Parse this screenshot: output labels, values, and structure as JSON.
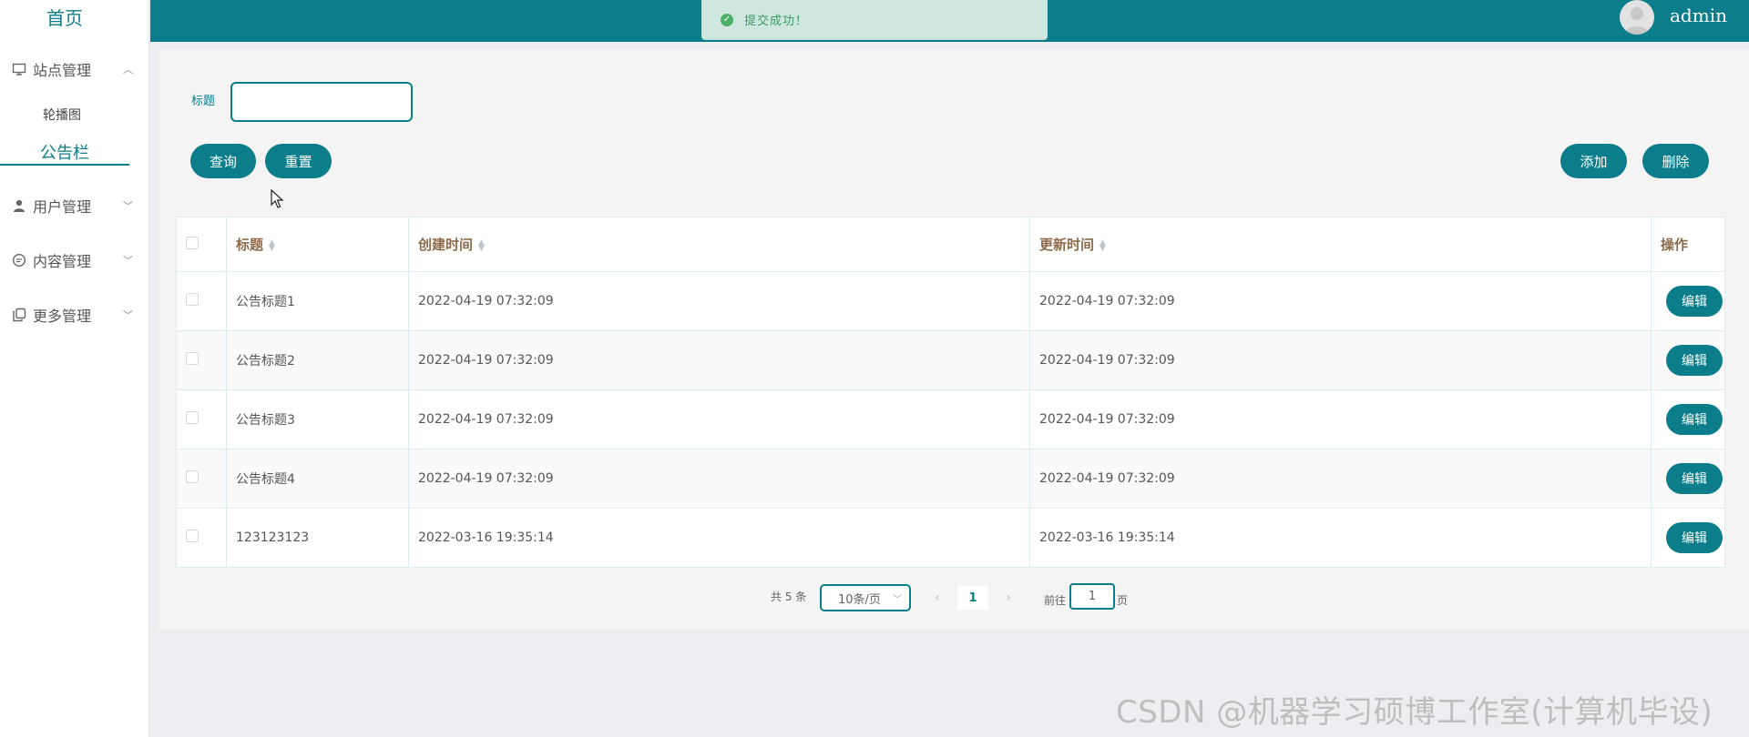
{
  "sidebar": {
    "home": "首页",
    "menus": [
      {
        "label": "站点管理",
        "icon": "monitor-icon",
        "expanded": true
      },
      {
        "label": "用户管理",
        "icon": "user-icon",
        "expanded": false
      },
      {
        "label": "内容管理",
        "icon": "chat-icon",
        "expanded": false
      },
      {
        "label": "更多管理",
        "icon": "copy-icon",
        "expanded": false
      }
    ],
    "site_sub": [
      "轮播图",
      "公告栏"
    ]
  },
  "header": {
    "username": "admin"
  },
  "toast": {
    "message": "提交成功！",
    "type": "success"
  },
  "search": {
    "title_label": "标题",
    "title_value": ""
  },
  "toolbar": {
    "query_label": "查询",
    "reset_label": "重置",
    "add_label": "添加",
    "delete_label": "删除"
  },
  "table": {
    "columns": [
      "标题",
      "创建时间",
      "更新时间",
      "操作"
    ],
    "rows": [
      {
        "title": "公告标题1",
        "created": "2022-04-19 07:32:09",
        "updated": "2022-04-19 07:32:09",
        "action": "编辑"
      },
      {
        "title": "公告标题2",
        "created": "2022-04-19 07:32:09",
        "updated": "2022-04-19 07:32:09",
        "action": "编辑"
      },
      {
        "title": "公告标题3",
        "created": "2022-04-19 07:32:09",
        "updated": "2022-04-19 07:32:09",
        "action": "编辑"
      },
      {
        "title": "公告标题4",
        "created": "2022-04-19 07:32:09",
        "updated": "2022-04-19 07:32:09",
        "action": "编辑"
      },
      {
        "title": "123123123",
        "created": "2022-03-16 19:35:14",
        "updated": "2022-03-16 19:35:14",
        "action": "编辑"
      }
    ]
  },
  "pagination": {
    "total_text": "共 5 条",
    "page_size": "10条/页",
    "current_page": "1",
    "goto_label": "前往",
    "goto_value": "1",
    "page_suffix": "页"
  },
  "watermark": "CSDN @机器学习硕博工作室(计算机毕设)",
  "colors": {
    "primary": "#0c7d8a",
    "header_text": "#8d6b4a",
    "toast_bg": "#cfe8df",
    "toast_text": "#3d9a62"
  }
}
